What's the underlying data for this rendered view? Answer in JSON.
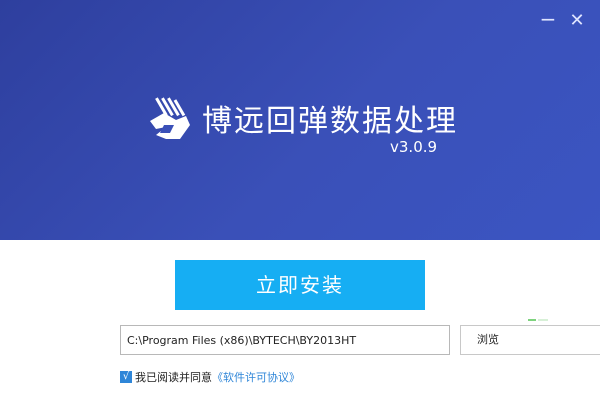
{
  "window": {
    "minimize_icon": "minimize-icon",
    "close_icon": "close-icon",
    "minimize_glyph": "−",
    "close_glyph": "✕"
  },
  "banner": {
    "title": "博远回弹数据处理",
    "version": "v3.0.9",
    "logo_icon": "byte-logo-icon"
  },
  "install": {
    "button_label": "立即安装"
  },
  "path": {
    "value": "C:\\Program Files (x86)\\BYTECH\\BY2013HT"
  },
  "browse": {
    "label": "浏览"
  },
  "agreement": {
    "checked": true,
    "check_glyph": "√",
    "prefix": "我已阅读并同意",
    "link": "《软件许可协议》"
  },
  "colors": {
    "banner": "#3a50b8",
    "install_button": "#16aef3",
    "link": "#2f86d8",
    "checkbox": "#2f86d8"
  }
}
